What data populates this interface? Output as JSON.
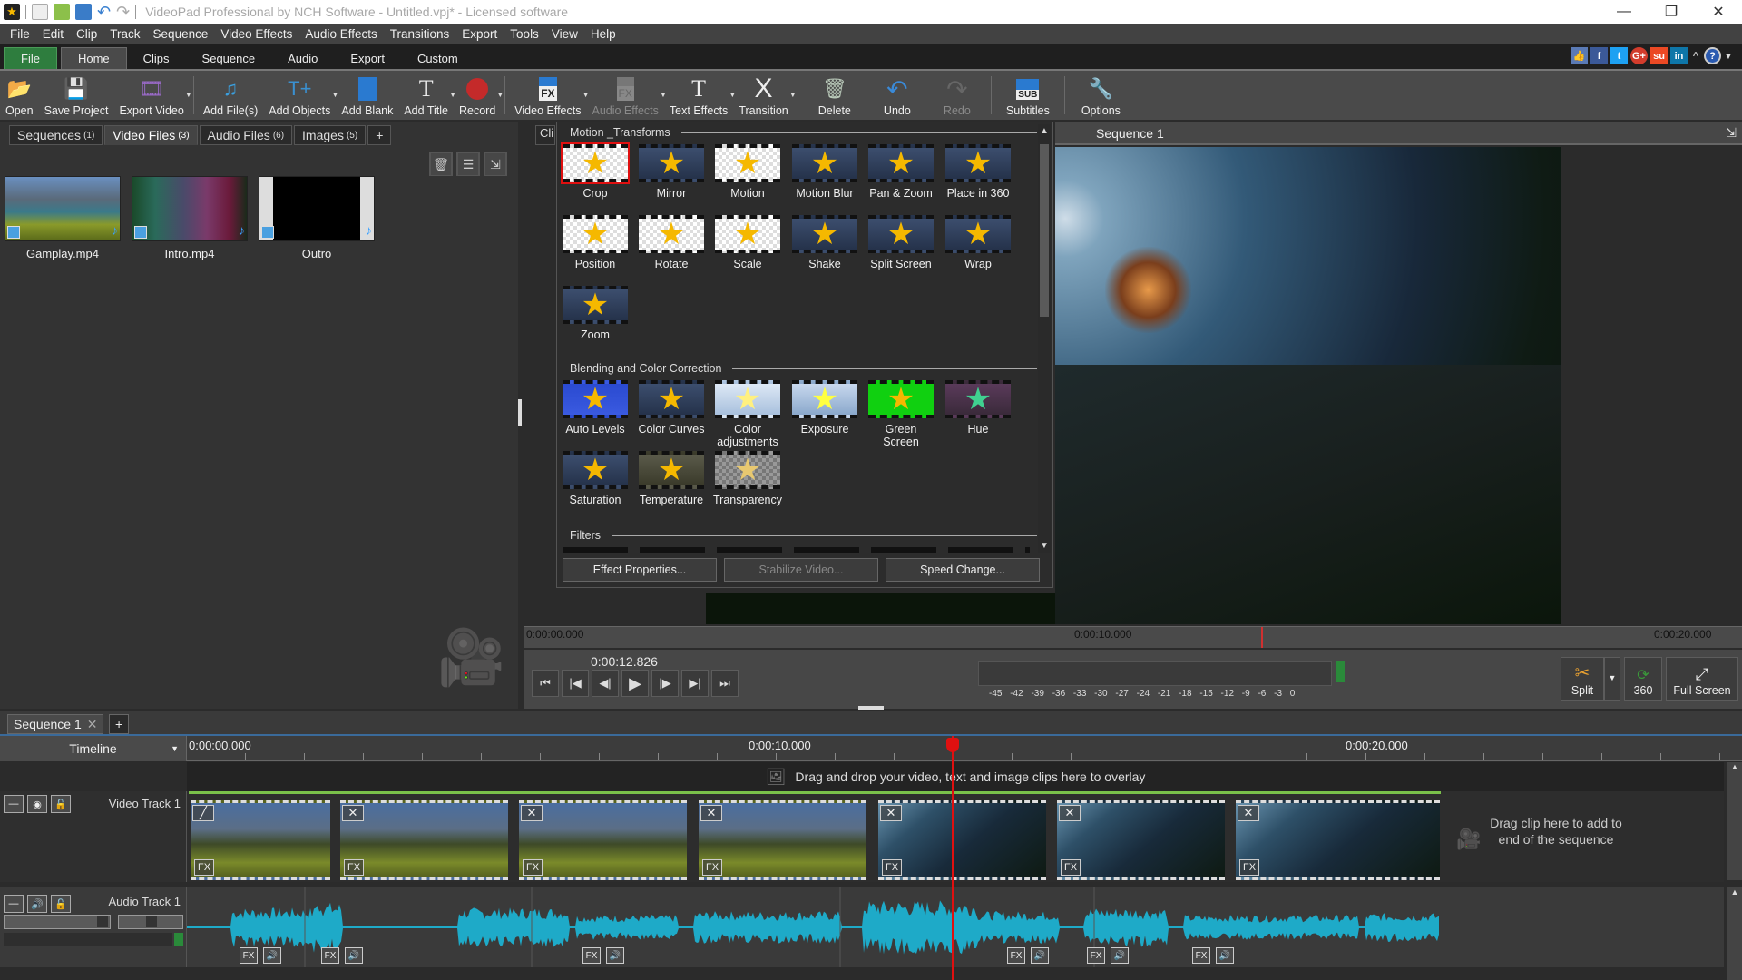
{
  "window": {
    "title": "VideoPad Professional by NCH Software - Untitled.vpj* - Licensed software",
    "controls": [
      "minimize",
      "restore",
      "close"
    ]
  },
  "menu": [
    "File",
    "Edit",
    "Clip",
    "Track",
    "Sequence",
    "Video Effects",
    "Audio Effects",
    "Transitions",
    "Export",
    "Tools",
    "View",
    "Help"
  ],
  "ribbon_tabs": {
    "file": "File",
    "items": [
      "Home",
      "Clips",
      "Sequence",
      "Audio",
      "Export",
      "Custom"
    ],
    "active": "Home"
  },
  "social": [
    "like",
    "facebook",
    "twitter",
    "google-plus",
    "stumbleupon",
    "linkedin"
  ],
  "toolbar": [
    {
      "label": "Open",
      "icon": "open-folder-icon"
    },
    {
      "label": "Save Project",
      "icon": "save-icon"
    },
    {
      "label": "Export Video",
      "icon": "export-video-icon",
      "dropdown": true
    },
    {
      "sep": true
    },
    {
      "label": "Add File(s)",
      "icon": "add-files-icon"
    },
    {
      "label": "Add Objects",
      "icon": "add-objects-icon",
      "dropdown": true
    },
    {
      "label": "Add Blank",
      "icon": "add-blank-icon"
    },
    {
      "label": "Add Title",
      "icon": "add-title-icon",
      "dropdown": true
    },
    {
      "label": "Record",
      "icon": "record-icon",
      "dropdown": true
    },
    {
      "sep": true
    },
    {
      "label": "Video Effects",
      "icon": "video-effects-icon",
      "dropdown": true
    },
    {
      "label": "Audio Effects",
      "icon": "audio-effects-icon",
      "dropdown": true,
      "disabled": true
    },
    {
      "label": "Text Effects",
      "icon": "text-effects-icon",
      "dropdown": true
    },
    {
      "label": "Transition",
      "icon": "transition-icon",
      "dropdown": true
    },
    {
      "sep": true
    },
    {
      "label": "Delete",
      "icon": "trash-icon"
    },
    {
      "label": "Undo",
      "icon": "undo-icon"
    },
    {
      "label": "Redo",
      "icon": "redo-icon",
      "disabled": true
    },
    {
      "sep": true
    },
    {
      "label": "Subtitles",
      "icon": "subtitles-icon"
    },
    {
      "sep": true
    },
    {
      "label": "Options",
      "icon": "options-icon"
    }
  ],
  "media_tabs": [
    {
      "label": "Sequences",
      "count": "(1)"
    },
    {
      "label": "Video Files",
      "count": "(3)",
      "active": true
    },
    {
      "label": "Audio Files",
      "count": "(6)"
    },
    {
      "label": "Images",
      "count": "(5)"
    },
    {
      "label": "+"
    }
  ],
  "media_files": [
    {
      "name": "Gamplay.mp4",
      "kind": "gameplay"
    },
    {
      "name": "Intro.mp4",
      "kind": "intro"
    },
    {
      "name": "Outro",
      "kind": "outro"
    }
  ],
  "clips_tab": "Cli",
  "effects": {
    "sections": [
      {
        "title": "Motion _Transforms",
        "items": [
          "Crop",
          "Mirror",
          "Motion",
          "Motion Blur",
          "Pan & Zoom",
          "Place in 360",
          "Position",
          "Rotate",
          "Scale",
          "Shake",
          "Split Screen",
          "Wrap",
          "Zoom"
        ]
      },
      {
        "title": "Blending and Color Correction",
        "items": [
          "Auto Levels",
          "Color Curves",
          "Color adjustments",
          "Exposure",
          "Green Screen",
          "Hue",
          "Saturation",
          "Temperature",
          "Transparency"
        ]
      },
      {
        "title": "Filters",
        "items": []
      }
    ],
    "buttons": [
      {
        "label": "Effect Properties...",
        "disabled": false
      },
      {
        "label": "Stabilize Video...",
        "disabled": true
      },
      {
        "label": "Speed Change...",
        "disabled": false
      }
    ]
  },
  "preview": {
    "title": "Sequence 1",
    "ruler": [
      "0:00:00.000",
      "0:00:10.000",
      "0:00:20.000"
    ],
    "timecode": "0:00:12.826",
    "transport": [
      "skip-to-start",
      "previous-clip",
      "step-back",
      "play",
      "step-forward",
      "next-clip",
      "skip-to-end"
    ],
    "meter_ticks": "-45 -42 -39 -36 -33 -30 -27 -24 -21 -18 -15 -12 -9 -6 -3 0",
    "buttons": {
      "split": "Split",
      "vr": "360",
      "fullscreen": "Full Screen"
    }
  },
  "timeline": {
    "tabs": [
      "Sequence 1"
    ],
    "mode": "Timeline",
    "ruler": [
      "0:00:00.000",
      "0:00:10.000",
      "0:00:20.000"
    ],
    "overlay_hint": "Drag and drop your video, text and image clips here to overlay",
    "video_track": {
      "label": "Video Track 1",
      "drop_hint": "Drag clip here to add to end of the sequence"
    },
    "audio_track": {
      "label": "Audio Track 1"
    },
    "fx_label": "FX"
  }
}
